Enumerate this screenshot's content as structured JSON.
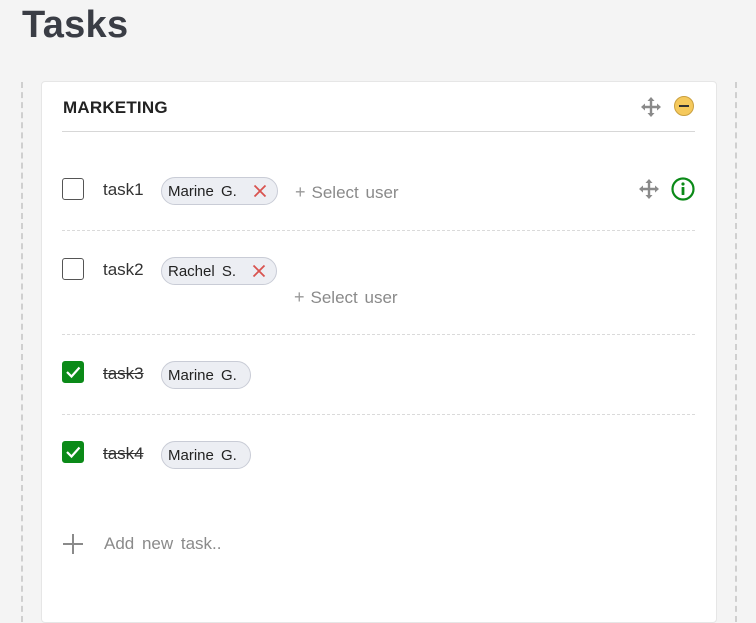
{
  "page": {
    "title": "Tasks"
  },
  "column": {
    "title": "MARKETING",
    "tasks": [
      {
        "name": "task1",
        "done": false,
        "assignees": [
          "Marine G."
        ],
        "select_user_label": "Select user"
      },
      {
        "name": "task2",
        "done": false,
        "assignees": [
          "Rachel S."
        ],
        "select_user_label": "Select user"
      },
      {
        "name": "task3",
        "done": true,
        "assignees": [
          "Marine G."
        ]
      },
      {
        "name": "task4",
        "done": true,
        "assignees": [
          "Marine G."
        ]
      }
    ],
    "add_task_placeholder": "Add new task.."
  },
  "colors": {
    "checked": "#0b8a18",
    "remove": "#d9534f",
    "collapse": "#f5c95c",
    "info": "#0b8a18"
  },
  "icons": {
    "move": "move-icon",
    "collapse": "minus-circle-icon",
    "info": "info-circle-icon",
    "remove": "close-icon",
    "add": "plus-icon"
  }
}
